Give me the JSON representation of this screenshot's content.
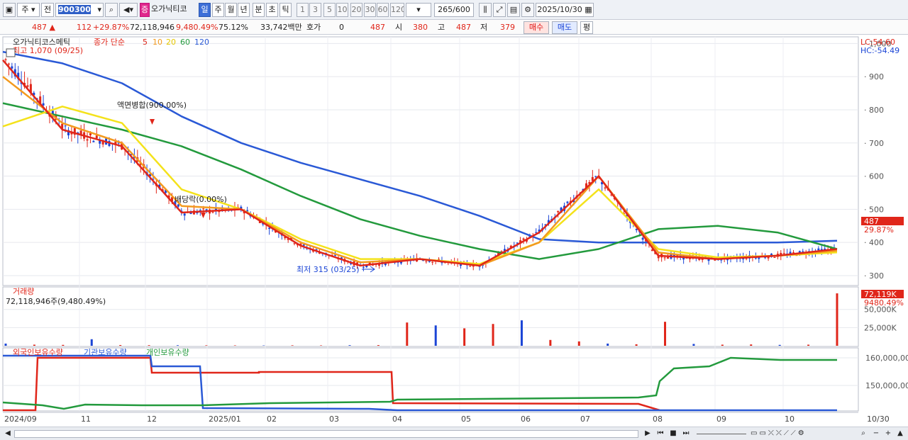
{
  "toolbar": {
    "period_label": "주",
    "prev_label": "전",
    "code_value": "900300",
    "stock_badge": "증",
    "stock_name": "오가닉티코",
    "timeframes": [
      "일",
      "주",
      "월",
      "년",
      "분",
      "초",
      "틱"
    ],
    "intervals": [
      "1",
      "3",
      "5",
      "10",
      "20",
      "30",
      "60",
      "120"
    ],
    "count_current": "265",
    "count_total": "/600",
    "date": "2025/10/30"
  },
  "infobar": {
    "price": "487",
    "change": "112",
    "change_pct": "+29.87%",
    "volume": "72,118,946",
    "volume_pct": "9,480.49%",
    "turnover_pct": "75.12%",
    "amount": "33,742백만",
    "hoga_label": "호가",
    "hoga_value": "0",
    "hoga_price": "487",
    "open_label": "시",
    "open_value": "380",
    "high_label": "고",
    "high_value": "487",
    "low_label": "저",
    "low_value": "379",
    "buy_label": "매수",
    "sell_label": "매도",
    "eval_label": "평"
  },
  "price_panel": {
    "legend_name": "오가닉티코스메틱",
    "legend_ma_label": "종가 단순",
    "legend_ma_periods": [
      "5",
      "10",
      "20",
      "60",
      "120"
    ],
    "high_note": "최고 1,070 (09/25)",
    "low_note": "최저 315 (03/25)",
    "event_split": "액면병합(900.00%)",
    "event_dividend": "배당락(0.00%)",
    "lc_label": "LC:54.60",
    "hc_label": "HC:-54.49",
    "current_price_tag": "487",
    "current_pct_tag": "29.87%",
    "colors": {
      "ma5": "#e0261a",
      "ma10": "#f39a1e",
      "ma20": "#f4e21b",
      "ma60": "#239a3d",
      "ma120": "#2a59d6",
      "up": "#e0261a",
      "down": "#1b45d6"
    }
  },
  "volume_panel": {
    "title": "거래량",
    "value_text": "72,118,946주(9,480.49%)",
    "tag_value": "72,119K",
    "tag_pct": "9480.49%"
  },
  "holdings_panel": {
    "legend": [
      "외국인보유수량",
      "기관보유수량",
      "개인보유수량"
    ],
    "colors": [
      "#e0261a",
      "#2a59d6",
      "#239a3d"
    ]
  },
  "xaxis_labels": [
    "2024/09",
    "11",
    "12",
    "2025/01",
    "02",
    "03",
    "04",
    "05",
    "06",
    "07",
    "08",
    "09",
    "10"
  ],
  "xaxis_right": "10/30",
  "chart_data": [
    {
      "type": "line",
      "title": "오가닉티코스메틱",
      "x": [
        "2024/09",
        "11",
        "12",
        "2025/01",
        "02",
        "03",
        "04",
        "05",
        "06",
        "07",
        "08",
        "09",
        "10",
        "10/30"
      ],
      "yticks": [
        "1,000",
        "900",
        "800",
        "700",
        "600",
        "500",
        "400",
        "300"
      ],
      "ylim": [
        270,
        1020
      ],
      "series": [
        {
          "name": "5",
          "values": [
            950,
            740,
            690,
            490,
            500,
            390,
            330,
            350,
            330,
            430,
            600,
            360,
            350,
            360,
            380
          ]
        },
        {
          "name": "10",
          "values": [
            900,
            760,
            700,
            510,
            500,
            400,
            340,
            350,
            330,
            400,
            600,
            370,
            350,
            360,
            375
          ]
        },
        {
          "name": "20",
          "values": [
            750,
            810,
            760,
            560,
            500,
            410,
            350,
            350,
            335,
            400,
            560,
            380,
            355,
            360,
            370
          ]
        },
        {
          "name": "60",
          "values": [
            820,
            780,
            740,
            690,
            620,
            540,
            470,
            420,
            380,
            350,
            380,
            440,
            450,
            430,
            380
          ]
        },
        {
          "name": "120",
          "values": [
            975,
            940,
            880,
            780,
            700,
            640,
            590,
            540,
            480,
            410,
            400,
            400,
            400,
            400,
            405
          ]
        }
      ],
      "grid": true,
      "legend": "top-left"
    },
    {
      "type": "bar",
      "title": "거래량",
      "yticks": [
        "50,000K",
        "25,000K"
      ],
      "ylim": [
        0,
        78000
      ],
      "values_k": [
        3000,
        1500,
        1200,
        9000,
        1000,
        800,
        700,
        600,
        500,
        400,
        600,
        500,
        800,
        900,
        32000,
        28000,
        24000,
        30000,
        35000,
        8000,
        6000,
        3000,
        2000,
        33000,
        2500,
        1500,
        1800,
        1200,
        1500,
        72119
      ],
      "last_value": "72,119K"
    },
    {
      "type": "line",
      "title": "보유수량",
      "yticks": [
        "160,000,00",
        "150,000,00"
      ],
      "series": [
        {
          "name": "외국인보유수량"
        },
        {
          "name": "기관보유수량"
        },
        {
          "name": "개인보유수량"
        }
      ],
      "legend": "top-left"
    }
  ]
}
